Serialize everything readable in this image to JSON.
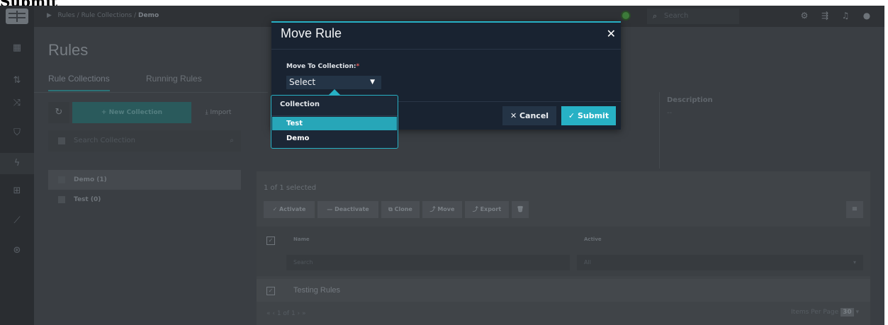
{
  "caption": "Submit",
  "breadcrumb": {
    "part1": "Rules",
    "part2": "Rule Collections",
    "part3": "Demo"
  },
  "topbar": {
    "search_placeholder": "Search"
  },
  "page": {
    "title": "Rules"
  },
  "tabs": [
    {
      "label": "Rule Collections"
    },
    {
      "label": "Running Rules"
    }
  ],
  "collections_panel": {
    "new_collection_label": "+ New Collection",
    "import_label": "⤓ Import",
    "search_placeholder": "Search Collection",
    "items": [
      {
        "label": "Demo (1)"
      },
      {
        "label": "Test (0)"
      }
    ]
  },
  "details": {
    "description_header": "Description",
    "description_value": "--"
  },
  "rules_panel": {
    "selected_text": "1 of 1 selected",
    "actions": [
      "✓ Activate",
      "— Deactivate",
      "⧉ Clone",
      "⤴ Move",
      "⤴ Export",
      "🗑"
    ],
    "columns": {
      "name": "Name",
      "active": "Active"
    },
    "filters": {
      "name_placeholder": "Search",
      "active_value": "All"
    },
    "rows": [
      {
        "name": "Testing Rules"
      }
    ],
    "pager_text": "«  ‹  1 of 1  ›  »",
    "items_per_page_label": "Items Per Page",
    "items_per_page_value": "30"
  },
  "modal": {
    "title": "Move Rule",
    "close_label": "✕",
    "field_label": "Move To Collection:",
    "required_mark": "*",
    "select_value": "Select",
    "cancel_label": "✕ Cancel",
    "submit_label": "✓ Submit"
  },
  "dropdown": {
    "header": "Collection",
    "options": [
      {
        "label": "Test",
        "highlighted": true
      },
      {
        "label": "Demo",
        "highlighted": false
      }
    ]
  },
  "colors": {
    "accent": "#27b1c5",
    "modal_bg": "#192331",
    "backdrop": "#3a3e43"
  }
}
